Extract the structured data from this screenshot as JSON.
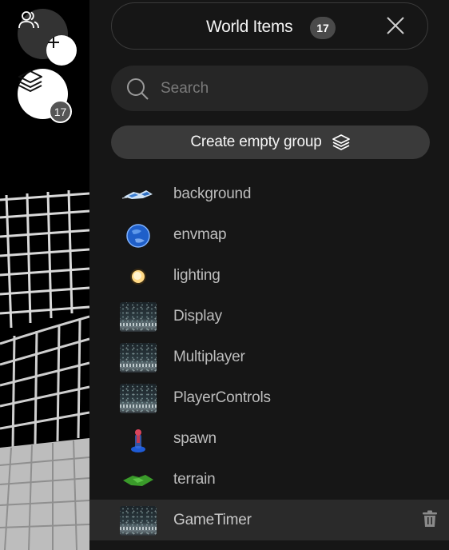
{
  "sidebar": {
    "users_icon": "users-icon",
    "add_icon": "plus-icon",
    "layers_icon": "layers-icon",
    "layers_badge": "17"
  },
  "panel": {
    "title": "World Items",
    "count": "17",
    "close_icon": "close-icon",
    "search_placeholder": "Search",
    "search_value": "",
    "create_group_label": "Create empty group",
    "items": [
      {
        "label": "background",
        "thumb": "background-thumb"
      },
      {
        "label": "envmap",
        "thumb": "envmap-thumb"
      },
      {
        "label": "lighting",
        "thumb": "lighting-thumb"
      },
      {
        "label": "Display",
        "thumb": "code-thumb"
      },
      {
        "label": "Multiplayer",
        "thumb": "code-thumb"
      },
      {
        "label": "PlayerControls",
        "thumb": "code-thumb"
      },
      {
        "label": "spawn",
        "thumb": "spawn-thumb"
      },
      {
        "label": "terrain",
        "thumb": "terrain-thumb"
      },
      {
        "label": "GameTimer",
        "thumb": "code-thumb",
        "selected": true
      }
    ]
  },
  "colors": {
    "panel_bg": "#161616",
    "pill_bg": "#262626",
    "button_bg": "#3a3a3a",
    "selected_row": "#2a2a2a"
  }
}
